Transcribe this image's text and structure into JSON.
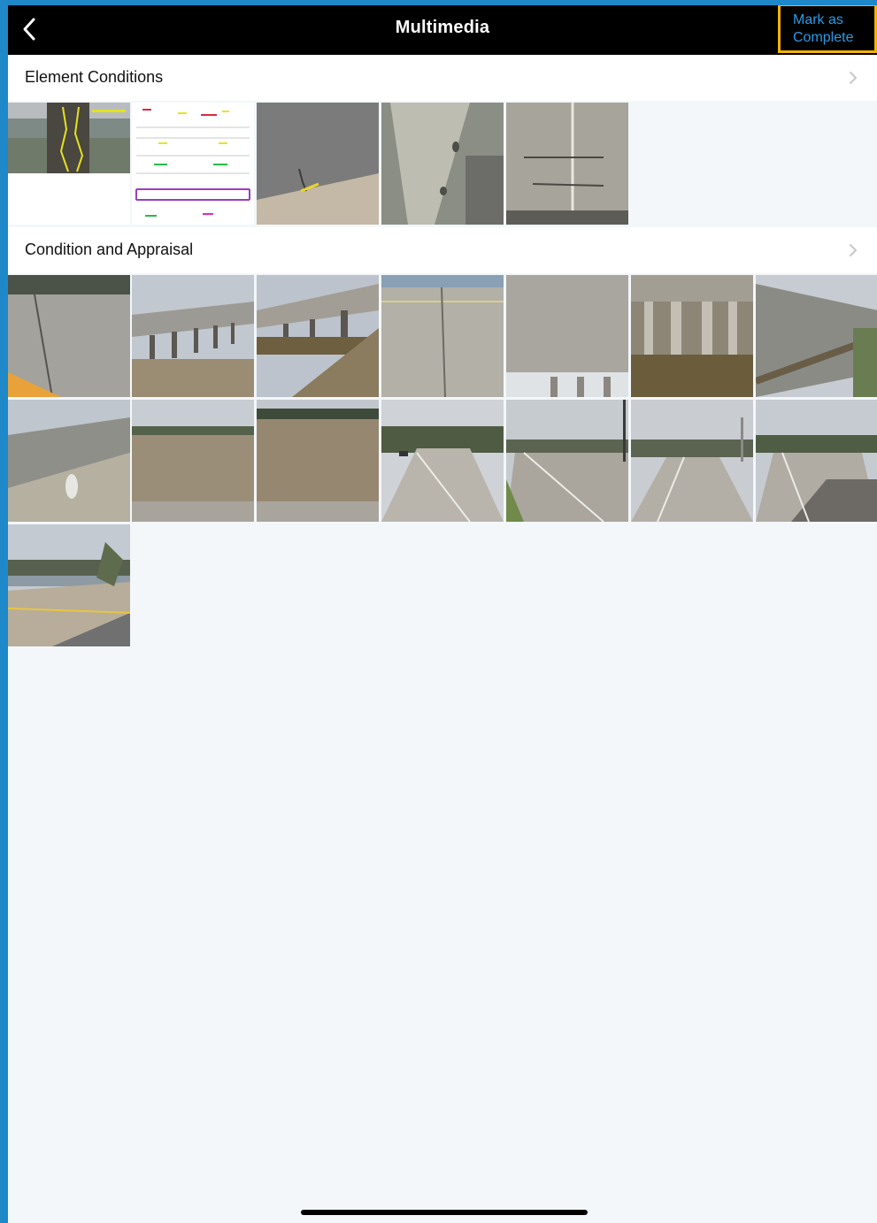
{
  "nav": {
    "title": "Multimedia",
    "back_icon": "chevron-left-icon",
    "mark_complete_line1": "Mark as",
    "mark_complete_line2": "Complete"
  },
  "sections": [
    {
      "title": "Element Conditions",
      "chevron_icon": "chevron-right-icon",
      "photos": [
        {
          "label": "pier-column-photo"
        },
        {
          "label": "diagram-sketch"
        },
        {
          "label": "concrete-wall-photo"
        },
        {
          "label": "stone-surface-photo"
        },
        {
          "label": "concrete-cracks-photo"
        }
      ]
    },
    {
      "title": "Condition and Appraisal",
      "chevron_icon": "chevron-right-icon",
      "photos": [
        {
          "label": "deck-joint-photo"
        },
        {
          "label": "bridge-side-photo"
        },
        {
          "label": "bridge-underside-photo"
        },
        {
          "label": "deck-surface-photo"
        },
        {
          "label": "soffit-photo"
        },
        {
          "label": "piers-water-photo"
        },
        {
          "label": "railing-photo"
        },
        {
          "label": "parapet-photo"
        },
        {
          "label": "river-photo-1"
        },
        {
          "label": "river-photo-2"
        },
        {
          "label": "approach-road-photo-1"
        },
        {
          "label": "approach-road-photo-2"
        },
        {
          "label": "approach-road-photo-3"
        },
        {
          "label": "approach-road-photo-4"
        },
        {
          "label": "approach-road-photo-5"
        }
      ]
    }
  ],
  "colors": {
    "navbar": "#000000",
    "accent": "#2d9be6",
    "highlight_border": "#f3b400",
    "background": "#f3f7fa"
  }
}
